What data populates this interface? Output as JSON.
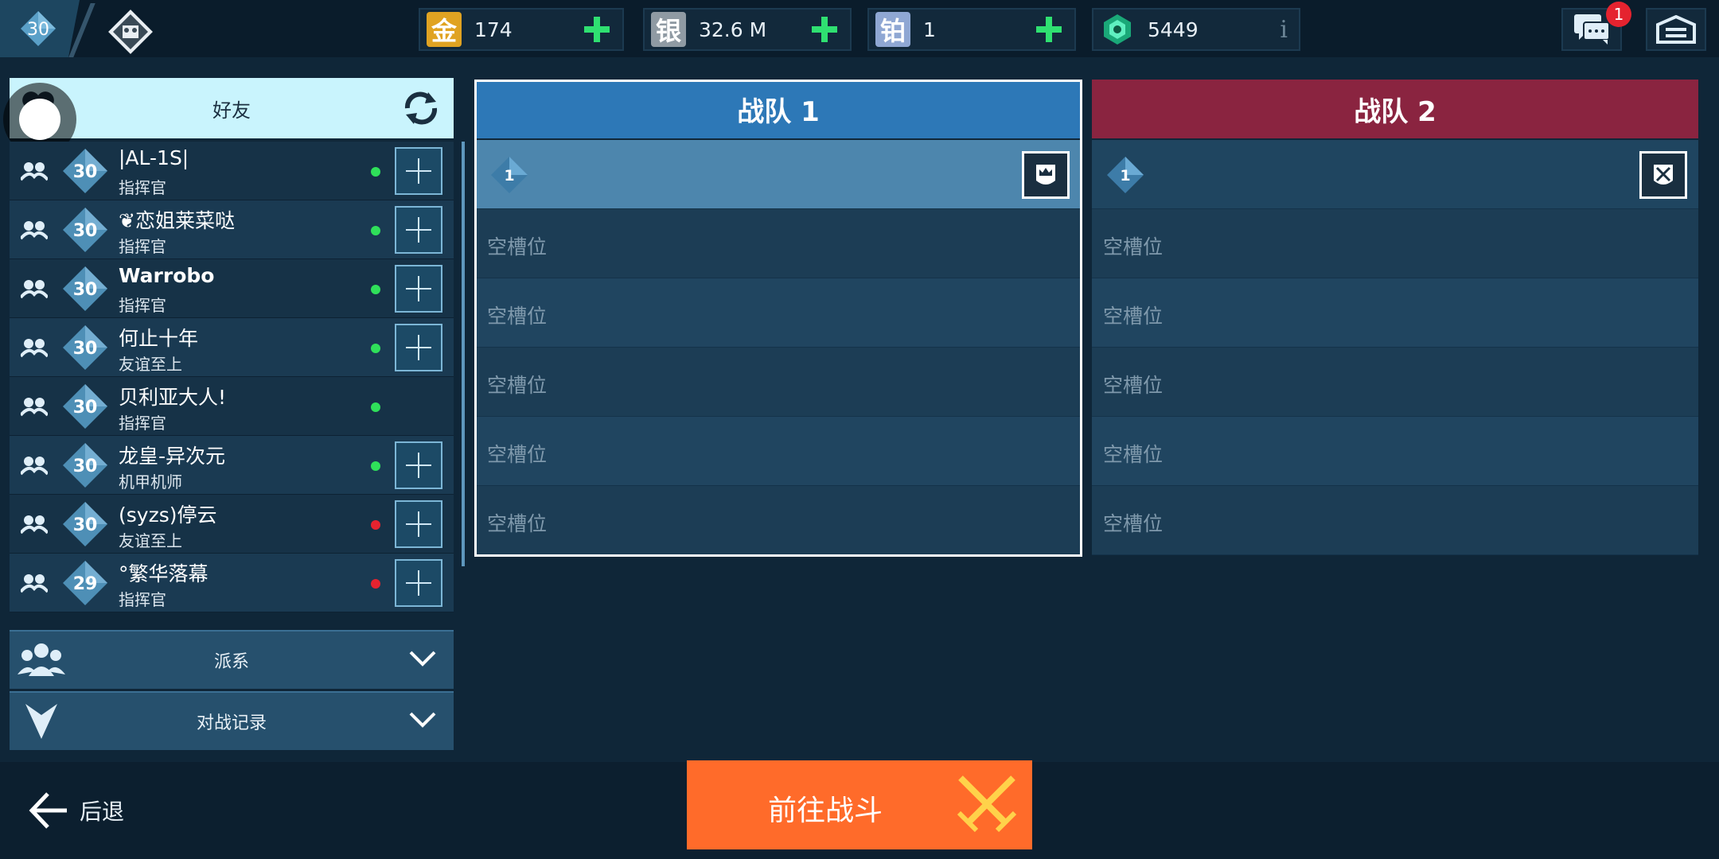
{
  "topbar": {
    "player_level": "30",
    "resources": [
      {
        "icon_char": "金",
        "icon_name": "gold-icon",
        "value": "174",
        "color": "#e0a322"
      },
      {
        "icon_char": "银",
        "icon_name": "silver-icon",
        "value": "32.6 M",
        "color": "#8f9aa3"
      },
      {
        "icon_char": "铂",
        "icon_name": "platinum-icon",
        "value": "1",
        "color": "#8fa7d3"
      },
      {
        "icon_char": "",
        "icon_name": "gem-icon",
        "value": "5449",
        "color": "#2fd89a"
      }
    ],
    "info_label": "i",
    "chat_badge": "1"
  },
  "friends": {
    "header": "好友",
    "list": [
      {
        "level": "30",
        "name": "|AL-1S|",
        "rank": "指挥官",
        "status": "online",
        "can_add": true
      },
      {
        "level": "30",
        "name": "❦恋姐莱菜哒",
        "rank": "指挥官",
        "status": "online",
        "can_add": true
      },
      {
        "level": "30",
        "name": "Warrobo",
        "rank": "指挥官",
        "status": "online",
        "can_add": true
      },
      {
        "level": "30",
        "name": "何止十年",
        "rank": "友谊至上",
        "status": "online",
        "can_add": true
      },
      {
        "level": "30",
        "name": "贝利亚大人!",
        "rank": "指挥官",
        "status": "online",
        "can_add": false
      },
      {
        "level": "30",
        "name": "龙皇-异次元",
        "rank": "机甲机师",
        "status": "online",
        "can_add": true
      },
      {
        "level": "30",
        "name": "(syzs)停云",
        "rank": "友谊至上",
        "status": "offline",
        "can_add": true
      },
      {
        "level": "29",
        "name": "°繁华落幕",
        "rank": "指挥官",
        "status": "offline",
        "can_add": true
      }
    ]
  },
  "sections": {
    "clan": "派系",
    "battle_log": "对战记录"
  },
  "team1": {
    "title": "战队 1",
    "leader_level": "1",
    "slots": [
      "空槽位",
      "空槽位",
      "空槽位",
      "空槽位",
      "空槽位"
    ]
  },
  "team2": {
    "title": "战队 2",
    "leader_level": "1",
    "slots": [
      "空槽位",
      "空槽位",
      "空槽位",
      "空槽位",
      "空槽位"
    ]
  },
  "bottom": {
    "back": "后退",
    "battle": "前往战斗"
  },
  "colors": {
    "team1": "#2d78b7",
    "team2": "#8a2440",
    "online": "#2fe05a",
    "offline": "#e5232f",
    "battle": "#ff6b2a"
  }
}
